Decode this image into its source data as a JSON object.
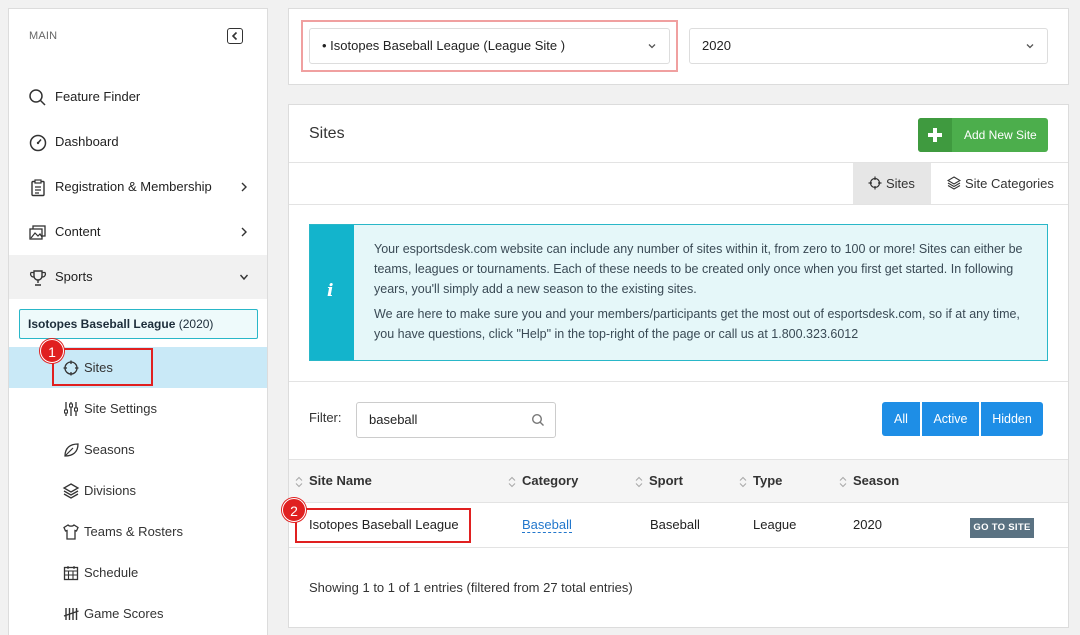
{
  "sidebar": {
    "heading": "MAIN",
    "items": [
      {
        "label": "Feature Finder"
      },
      {
        "label": "Dashboard"
      },
      {
        "label": "Registration & Membership"
      },
      {
        "label": "Content"
      },
      {
        "label": "Sports"
      }
    ],
    "league": {
      "name": "Isotopes Baseball League",
      "season": "(2020)"
    },
    "subitems": [
      {
        "label": "Sites"
      },
      {
        "label": "Site Settings"
      },
      {
        "label": "Seasons"
      },
      {
        "label": "Divisions"
      },
      {
        "label": "Teams & Rosters"
      },
      {
        "label": "Schedule"
      },
      {
        "label": "Game Scores"
      }
    ]
  },
  "topbar": {
    "site_select": "• Isotopes Baseball League (League Site )",
    "year_select": "2020"
  },
  "card": {
    "title": "Sites",
    "add_button": "Add New Site",
    "tabs": [
      {
        "label": "Sites"
      },
      {
        "label": "Site Categories"
      }
    ],
    "info": {
      "icon": "i",
      "para1": "Your esportsdesk.com website can include any number of sites within it, from zero to 100 or more! Sites can either be teams, leagues or tournaments. Each of these needs to be created only once when you first get started. In following years, you'll simply add a new season to the existing sites.",
      "para2": "We are here to make sure you and your members/participants get the most out of esportsdesk.com, so if at any time, you have questions, click \"Help\" in the top-right of the page or call us at 1.800.323.6012"
    },
    "filter": {
      "label": "Filter:",
      "value": "baseball"
    },
    "segments": [
      "All",
      "Active",
      "Hidden"
    ],
    "columns": [
      "Site Name",
      "Category",
      "Sport",
      "Type",
      "Season"
    ],
    "rows": [
      {
        "site_name": "Isotopes Baseball League",
        "category": "Baseball",
        "sport": "Baseball",
        "type": "League",
        "season": "2020",
        "action": "GO TO SITE"
      }
    ],
    "footer": "Showing 1 to 1 of 1 entries (filtered from 27 total entries)"
  },
  "annotations": {
    "badge1": "1",
    "badge2": "2"
  },
  "colors": {
    "accent_green": "#4cae4c",
    "accent_blue": "#1e8ee6",
    "info_teal": "#13b4cc",
    "annotation_red": "#e02020",
    "active_nav": "#c9e9f7"
  }
}
